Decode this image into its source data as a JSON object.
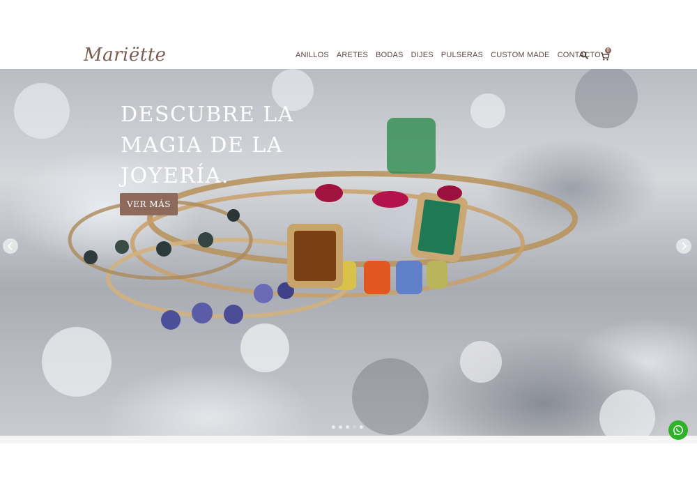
{
  "brand": {
    "logo_text": "Mariëtte"
  },
  "nav": {
    "items": [
      {
        "label": "ANILLOS"
      },
      {
        "label": "ARETES"
      },
      {
        "label": "BODAS"
      },
      {
        "label": "DIJES"
      },
      {
        "label": "PULSERAS"
      },
      {
        "label": "CUSTOM MADE"
      },
      {
        "label": "CONTACTO"
      }
    ],
    "search_icon": "search-icon",
    "cart_icon": "cart-icon",
    "cart_count": "0"
  },
  "hero": {
    "title_lines": [
      "DESCUBRE LA",
      "MAGIA DE LA",
      "JOYERÍA."
    ],
    "cta_label": "VER MÁS",
    "prev_icon": "chevron-left-icon",
    "next_icon": "chevron-right-icon",
    "slides_count": 5,
    "active_slide": 4
  },
  "whatsapp": {
    "icon": "whatsapp-icon"
  },
  "colors": {
    "accent": "#8d6a5c",
    "nav_text": "#5a4740",
    "whatsapp": "#2fb12a"
  }
}
